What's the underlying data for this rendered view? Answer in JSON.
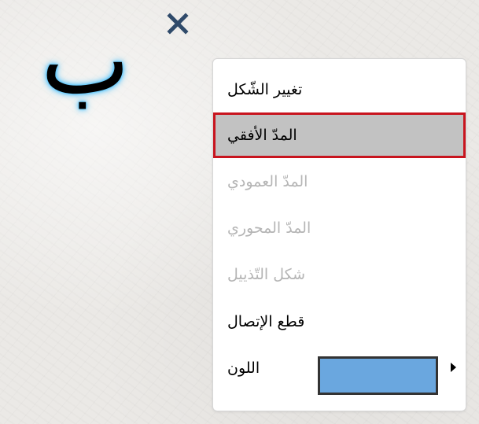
{
  "canvas": {
    "letter": "ب",
    "glow_color": "#4ec3ff",
    "close_icon": "close-x-icon",
    "close_icon_color": "#2f4a6a"
  },
  "context_menu": {
    "items": [
      {
        "label": "تغيير الشّكل",
        "enabled": true,
        "selected": false
      },
      {
        "label": "المدّ الأفقي",
        "enabled": true,
        "selected": true
      },
      {
        "label": "المدّ العمودي",
        "enabled": false,
        "selected": false
      },
      {
        "label": "المدّ المحوري",
        "enabled": false,
        "selected": false
      },
      {
        "label": "شكل التّذييل",
        "enabled": false,
        "selected": false
      },
      {
        "label": "قطع الإتصال",
        "enabled": true,
        "selected": false
      },
      {
        "label": "اللون",
        "enabled": true,
        "selected": false
      }
    ],
    "color_value": "#6aa7df",
    "submenu_arrow_icon": "triangle-right-icon",
    "highlight_border_color": "#c8141e",
    "highlight_bg_color": "#c2c2c2"
  }
}
